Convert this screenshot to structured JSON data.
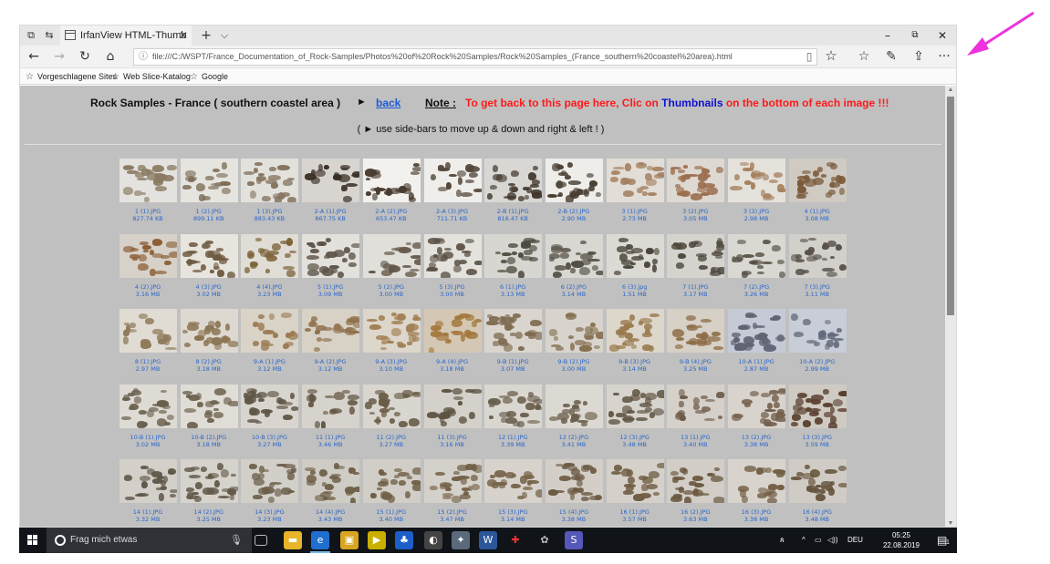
{
  "browser": {
    "tab_title": "IrfanView HTML-Thumb",
    "tab_close": "✕",
    "new_tab": "+",
    "tab_menu": "⌵",
    "address": "file:///C:/WSPT/France_Documentation_of_Rock-Samples/Photos%20of%20Rock%20Samples/Rock%20Samples_(France_southern%20coastel%20area).html",
    "favorites": [
      "Vorgeschlagene Sites",
      "Web Slice-Katalog",
      "Google"
    ]
  },
  "page": {
    "title": "Rock Samples - France  ( southern coastel area )",
    "arrow": "►",
    "back_link": "back",
    "note_label": "Note :",
    "note_text_1": "To get back to this page here, Clic on ",
    "note_text_blue": "Thumbnails",
    "note_text_2": " on the bottom of each image !!!",
    "subline": "( ► use side-bars to move up & down and right & left ! )"
  },
  "thumbnails": [
    {
      "name": "1 (1).JPG",
      "size": "827.74 KB",
      "bg": "#e4e2de",
      "rock": "#8a7a62"
    },
    {
      "name": "1 (2).JPG",
      "size": "899.11 KB",
      "bg": "#e6e4df",
      "rock": "#7d6e58"
    },
    {
      "name": "1 (3).JPG",
      "size": "883.43 KB",
      "bg": "#e3e1dc",
      "rock": "#857561"
    },
    {
      "name": "2-A (1).JPG",
      "size": "867.75 KB",
      "bg": "#d8d4cf",
      "rock": "#3b3027"
    },
    {
      "name": "2-A (2).JPG",
      "size": "653.47 KB",
      "bg": "#f2f1ee",
      "rock": "#4a3c30"
    },
    {
      "name": "2-A (3).JPG",
      "size": "711.71 KB",
      "bg": "#efeeeb",
      "rock": "#53473a"
    },
    {
      "name": "2-B (1).JPG",
      "size": "816.47 KB",
      "bg": "#d9d7d3",
      "rock": "#3e342b"
    },
    {
      "name": "2-B (2).JPG",
      "size": "2.90 MB",
      "bg": "#eeede9",
      "rock": "#4b4034"
    },
    {
      "name": "3 (1).JPG",
      "size": "2.73 MB",
      "bg": "#e2ddd6",
      "rock": "#a07c5c"
    },
    {
      "name": "3 (2).JPG",
      "size": "3.05 MB",
      "bg": "#ddd8d1",
      "rock": "#9b6f4f"
    },
    {
      "name": "3 (3).JPG",
      "size": "2.98 MB",
      "bg": "#e5e1db",
      "rock": "#a6815f"
    },
    {
      "name": "4 (1).JPG",
      "size": "3.08 MB",
      "bg": "#cfcac2",
      "rock": "#7a5a3a"
    },
    {
      "name": "4 (2).JPG",
      "size": "3.16 MB",
      "bg": "#d6d1c9",
      "rock": "#8d5e35"
    },
    {
      "name": "4 (3).JPG",
      "size": "3.02 MB",
      "bg": "#e8e5df",
      "rock": "#6e5a40"
    },
    {
      "name": "4 (4).JPG",
      "size": "3.23 MB",
      "bg": "#e0ddd6",
      "rock": "#7c6238"
    },
    {
      "name": "5 (1).JPG",
      "size": "3.09 MB",
      "bg": "#e3e1dc",
      "rock": "#5d5448"
    },
    {
      "name": "5 (2).JPG",
      "size": "3.00 MB",
      "bg": "#e1dfda",
      "rock": "#625748"
    },
    {
      "name": "5 (3).JPG",
      "size": "3.00 MB",
      "bg": "#e4e2dd",
      "rock": "#5a5044"
    },
    {
      "name": "6 (1).JPG",
      "size": "3.13 MB",
      "bg": "#d8d6d1",
      "rock": "#4e4a40"
    },
    {
      "name": "6 (2).JPG",
      "size": "3.14 MB",
      "bg": "#d9d7d2",
      "rock": "#524d42"
    },
    {
      "name": "6 (3).jpg",
      "size": "1.51 MB",
      "bg": "#dcdad5",
      "rock": "#4a4439"
    },
    {
      "name": "7 (1).JPG",
      "size": "3.17 MB",
      "bg": "#d5d3ce",
      "rock": "#4d473c"
    },
    {
      "name": "7 (2).JPG",
      "size": "3.26 MB",
      "bg": "#dad8d3",
      "rock": "#554e42"
    },
    {
      "name": "7 (3).JPG",
      "size": "3.11 MB",
      "bg": "#d2d0cb",
      "rock": "#58514a"
    },
    {
      "name": "8 (1).JPG",
      "size": "2.97 MB",
      "bg": "#e0dcd3",
      "rock": "#8e7a5a"
    },
    {
      "name": "8 (2).JPG",
      "size": "3.18 MB",
      "bg": "#ded9d0",
      "rock": "#8a7453"
    },
    {
      "name": "9-A (1).JPG",
      "size": "3.12 MB",
      "bg": "#d9d3c8",
      "rock": "#9a7a52"
    },
    {
      "name": "9-A (2).JPG",
      "size": "3.12 MB",
      "bg": "#d7d1c6",
      "rock": "#8f704a"
    },
    {
      "name": "9-A (3).JPG",
      "size": "3.10 MB",
      "bg": "#dcd6cb",
      "rock": "#a28055"
    },
    {
      "name": "9-A (4).JPG",
      "size": "3.18 MB",
      "bg": "#d4c8b4",
      "rock": "#a3793e"
    },
    {
      "name": "9-B (1).JPG",
      "size": "3.07 MB",
      "bg": "#dad6cf",
      "rock": "#7f6c52"
    },
    {
      "name": "9-B (2).JPG",
      "size": "3.00 MB",
      "bg": "#d8d4cd",
      "rock": "#85704f"
    },
    {
      "name": "9-B (3).JPG",
      "size": "3.14 MB",
      "bg": "#ddd6cb",
      "rock": "#9a7b50"
    },
    {
      "name": "9-B (4).JPG",
      "size": "3.25 MB",
      "bg": "#d6d0c6",
      "rock": "#8c6b44"
    },
    {
      "name": "10-A (1).JPG",
      "size": "2.87 MB",
      "bg": "#c6cad6",
      "rock": "#5f6374"
    },
    {
      "name": "10-A (2).JPG",
      "size": "2.99 MB",
      "bg": "#c9cdd8",
      "rock": "#646a7c"
    },
    {
      "name": "10-B (1).JPG",
      "size": "3.02 MB",
      "bg": "#dedbd4",
      "rock": "#6a604e"
    },
    {
      "name": "10-B (2).JPG",
      "size": "3.18 MB",
      "bg": "#e0ddd6",
      "rock": "#6e6350"
    },
    {
      "name": "10-B (3).JPG",
      "size": "3.27 MB",
      "bg": "#d8d5cf",
      "rock": "#5e5444"
    },
    {
      "name": "11 (1).JPG",
      "size": "3.46 MB",
      "bg": "#d6d3cc",
      "rock": "#645845"
    },
    {
      "name": "11 (2).JPG",
      "size": "3.27 MB",
      "bg": "#d9d6cf",
      "rock": "#6a5d48"
    },
    {
      "name": "11 (3).JPG",
      "size": "3.16 MB",
      "bg": "#d4d1ca",
      "rock": "#5d5241"
    },
    {
      "name": "12 (1).JPG",
      "size": "3.39 MB",
      "bg": "#dad7d0",
      "rock": "#675c4a"
    },
    {
      "name": "12 (2).JPG",
      "size": "3.41 MB",
      "bg": "#dcd9d2",
      "rock": "#6b604d"
    },
    {
      "name": "12 (3).JPG",
      "size": "3.48 MB",
      "bg": "#d7d4cd",
      "rock": "#625746"
    },
    {
      "name": "13 (1).JPG",
      "size": "3.40 MB",
      "bg": "#d5d1ca",
      "rock": "#6e5a48"
    },
    {
      "name": "13 (2).JPG",
      "size": "3.38 MB",
      "bg": "#d8d4cd",
      "rock": "#725e4b"
    },
    {
      "name": "13 (3).JPG",
      "size": "3.59 MB",
      "bg": "#cfcbc3",
      "rock": "#5a4030"
    },
    {
      "name": "14 (1).JPG",
      "size": "3.32 MB",
      "bg": "#d3d0c9",
      "rock": "#5e5648"
    },
    {
      "name": "14 (2).JPG",
      "size": "3.25 MB",
      "bg": "#d6d3cc",
      "rock": "#635a4b"
    },
    {
      "name": "14 (3).JPG",
      "size": "3.23 MB",
      "bg": "#d2cfc8",
      "rock": "#6a5c48"
    },
    {
      "name": "14 (4).JPG",
      "size": "3.43 MB",
      "bg": "#cfccc5",
      "rock": "#6f6148"
    },
    {
      "name": "15 (1).JPG",
      "size": "3.40 MB",
      "bg": "#d1cec7",
      "rock": "#6d5d45"
    },
    {
      "name": "15 (2).JPG",
      "size": "3.47 MB",
      "bg": "#d4d1ca",
      "rock": "#725f46"
    },
    {
      "name": "15 (3).JPG",
      "size": "3.14 MB",
      "bg": "#d7d3cc",
      "rock": "#766349"
    },
    {
      "name": "15 (4).JPG",
      "size": "3.38 MB",
      "bg": "#d3cfc8",
      "rock": "#6c5a43"
    },
    {
      "name": "16 (1).JPG",
      "size": "3.57 MB",
      "bg": "#d5d1ca",
      "rock": "#705d44"
    },
    {
      "name": "16 (2).JPG",
      "size": "3.63 MB",
      "bg": "#d2cec7",
      "rock": "#6a5840"
    },
    {
      "name": "16 (3).JPG",
      "size": "3.38 MB",
      "bg": "#d8d4cd",
      "rock": "#735f45"
    },
    {
      "name": "16 (4).JPG",
      "size": "3.48 MB",
      "bg": "#d0ccc5",
      "rock": "#67553e"
    }
  ],
  "taskbar": {
    "search_placeholder": "Frag mich etwas",
    "language": "DEU",
    "time": "05:25",
    "date": "22.08.2019",
    "notifications_count": "1"
  },
  "colors": {
    "page_bg": "#c0c0c0",
    "link_blue": "#1a5ad7",
    "note_red": "#ff1a1a",
    "caption_blue": "#2a66c9",
    "annotation_arrow": "#ee33dd"
  }
}
